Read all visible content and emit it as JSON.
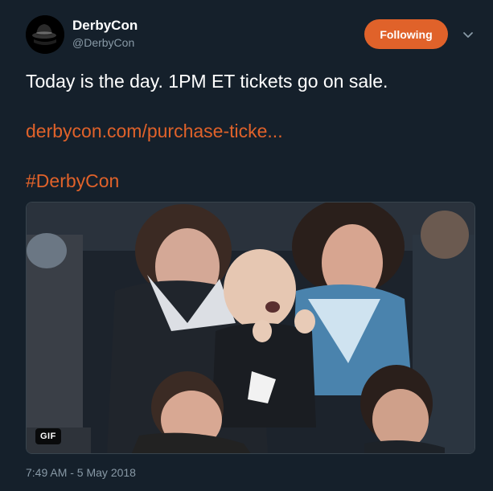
{
  "author": {
    "name": "DerbyCon",
    "handle": "@DerbyCon"
  },
  "follow_button": {
    "label": "Following"
  },
  "tweet": {
    "text": "Today is the day. 1PM ET tickets go on sale.",
    "link": "derbycon.com/purchase-ticke...",
    "hashtag": "#DerbyCon"
  },
  "media": {
    "badge": "GIF"
  },
  "timestamp": "7:49 AM - 5 May 2018",
  "colors": {
    "background": "#15202b",
    "accent": "#e0622a",
    "muted": "#8899a6"
  },
  "icons": {
    "menu": "chevron-down-icon"
  }
}
